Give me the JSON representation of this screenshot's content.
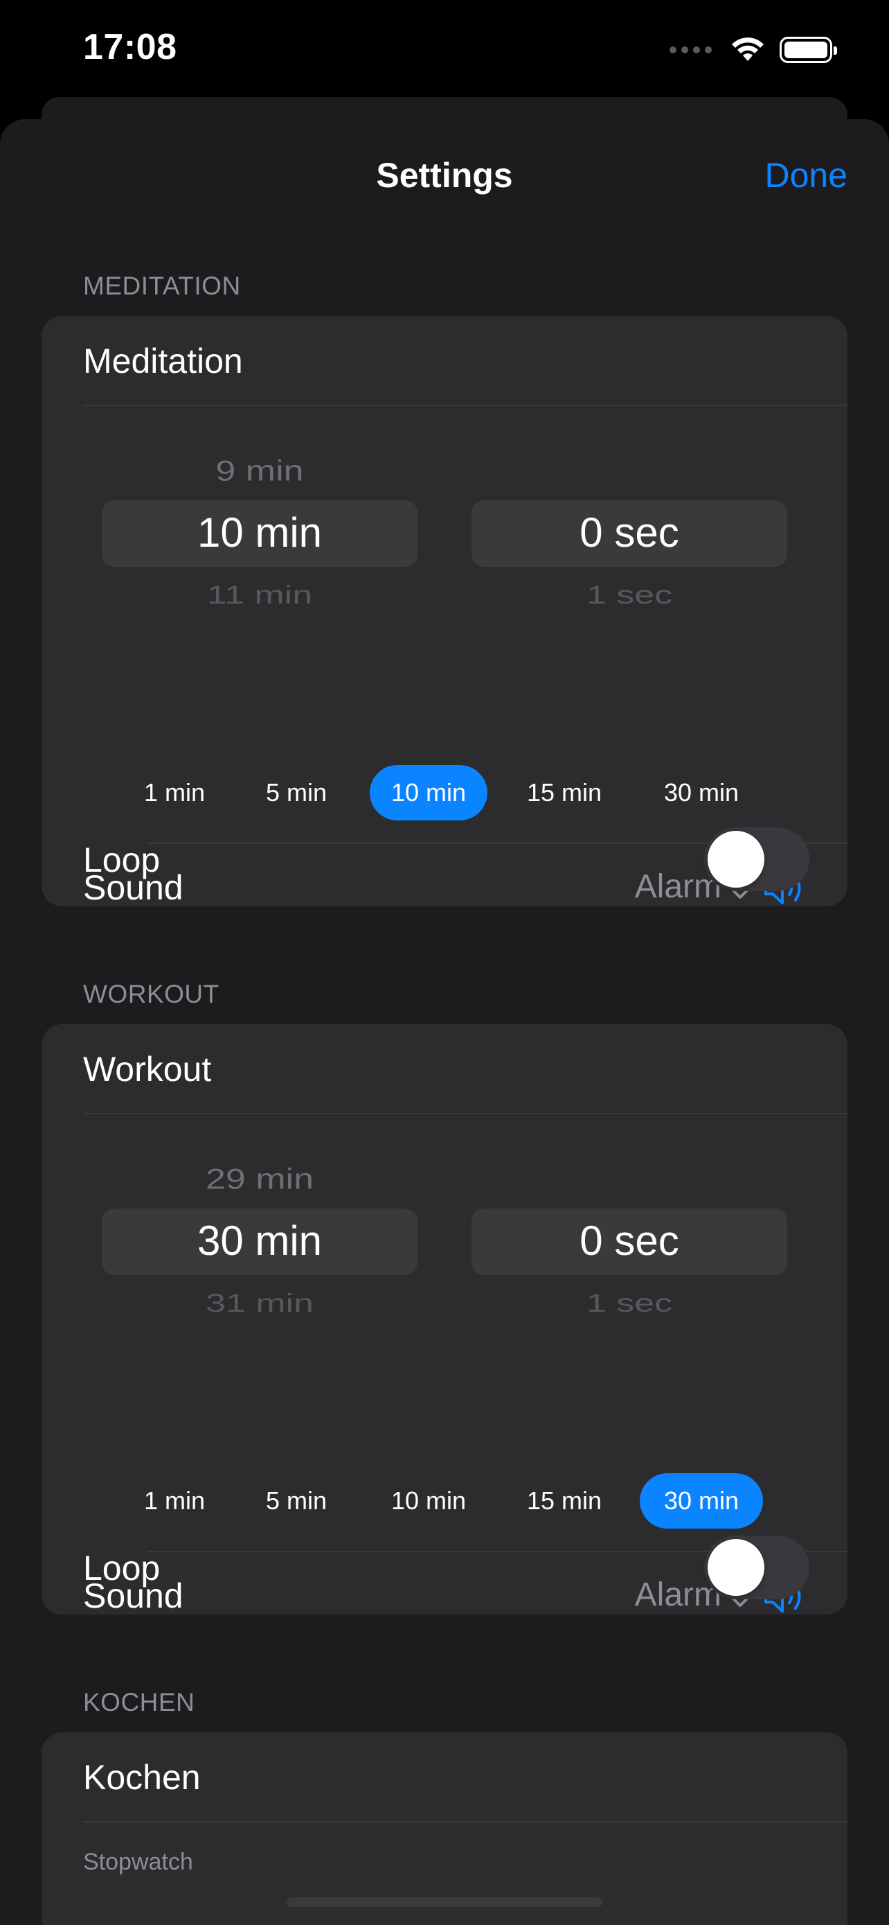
{
  "status_bar": {
    "time": "17:08"
  },
  "nav": {
    "title": "Settings",
    "done_label": "Done"
  },
  "sections": {
    "meditation": {
      "header": "MEDITATION",
      "title": "Meditation",
      "minutes_picker": {
        "above": "9 min",
        "selected": "10 min",
        "below": "11 min"
      },
      "seconds_picker": {
        "above": "",
        "selected": "0 sec",
        "below": "1 sec"
      },
      "presets": [
        "1 min",
        "5 min",
        "10 min",
        "15 min",
        "30 min"
      ],
      "selected_preset": "10 min",
      "sound_label": "Sound",
      "sound_value": "Alarm",
      "loop_label": "Loop",
      "loop_on": false
    },
    "workout": {
      "header": "WORKOUT",
      "title": "Workout",
      "minutes_picker": {
        "above": "29 min",
        "selected": "30 min",
        "below": "31 min"
      },
      "seconds_picker": {
        "above": "",
        "selected": "0 sec",
        "below": "1 sec"
      },
      "presets": [
        "1 min",
        "5 min",
        "10 min",
        "15 min",
        "30 min"
      ],
      "selected_preset": "30 min",
      "sound_label": "Sound",
      "sound_value": "Alarm",
      "loop_label": "Loop",
      "loop_on": false
    },
    "kochen": {
      "header": "KOCHEN",
      "title": "Kochen",
      "mode_label": "Stopwatch"
    }
  },
  "icons": {
    "wifi": "wifi-icon",
    "battery": "battery-icon",
    "sound_selector": "chevron-up-down-icon",
    "speaker": "speaker-wave-icon"
  },
  "colors": {
    "accent": "#0a84ff",
    "background": "#1c1c1e",
    "card": "#2c2c2e",
    "secondary_text": "#8d8d93"
  }
}
